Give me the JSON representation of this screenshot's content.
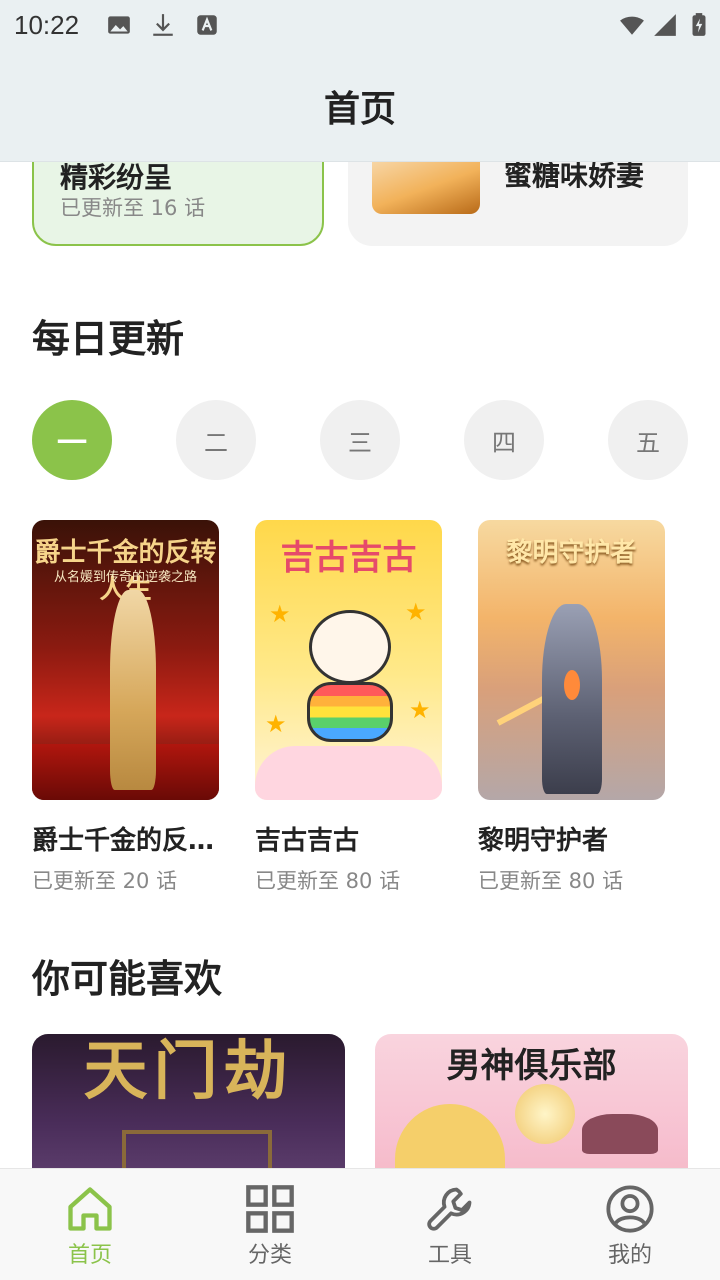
{
  "status_bar": {
    "time": "10:22",
    "left_icons": [
      "image-icon",
      "download-icon",
      "font-icon"
    ],
    "right_icons": [
      "wifi-icon",
      "signal-icon",
      "battery-icon"
    ]
  },
  "header": {
    "title": "首页"
  },
  "featured": [
    {
      "title": "精彩纷呈",
      "subtitle": "已更新至 16 话",
      "selected": true
    },
    {
      "title": "蜜糖味娇妻"
    }
  ],
  "daily": {
    "title": "每日更新",
    "days": [
      "一",
      "二",
      "三",
      "四",
      "五"
    ],
    "active_day": "一",
    "books": [
      {
        "name": "爵士千金的反…",
        "subtitle": "已更新至 20 话",
        "cover_title": "爵士千金的反转人生",
        "cover_caption": "从名媛到传奇的逆袭之路"
      },
      {
        "name": "吉古吉古",
        "subtitle": "已更新至 80 话",
        "cover_title": "吉古吉古"
      },
      {
        "name": "黎明守护者",
        "subtitle": "已更新至 80 话",
        "cover_title": "黎明守护者"
      }
    ]
  },
  "likes": {
    "title": "你可能喜欢",
    "items": [
      {
        "cover_title": "天门劫"
      },
      {
        "cover_title": "男神俱乐部"
      }
    ]
  },
  "bottom_nav": {
    "active": "首页",
    "items": [
      {
        "label": "首页",
        "icon": "home-icon"
      },
      {
        "label": "分类",
        "icon": "grid-icon"
      },
      {
        "label": "工具",
        "icon": "wrench-icon"
      },
      {
        "label": "我的",
        "icon": "profile-icon"
      }
    ]
  },
  "colors": {
    "accent": "#8bc34a",
    "header_bg": "#eaf0f2"
  }
}
